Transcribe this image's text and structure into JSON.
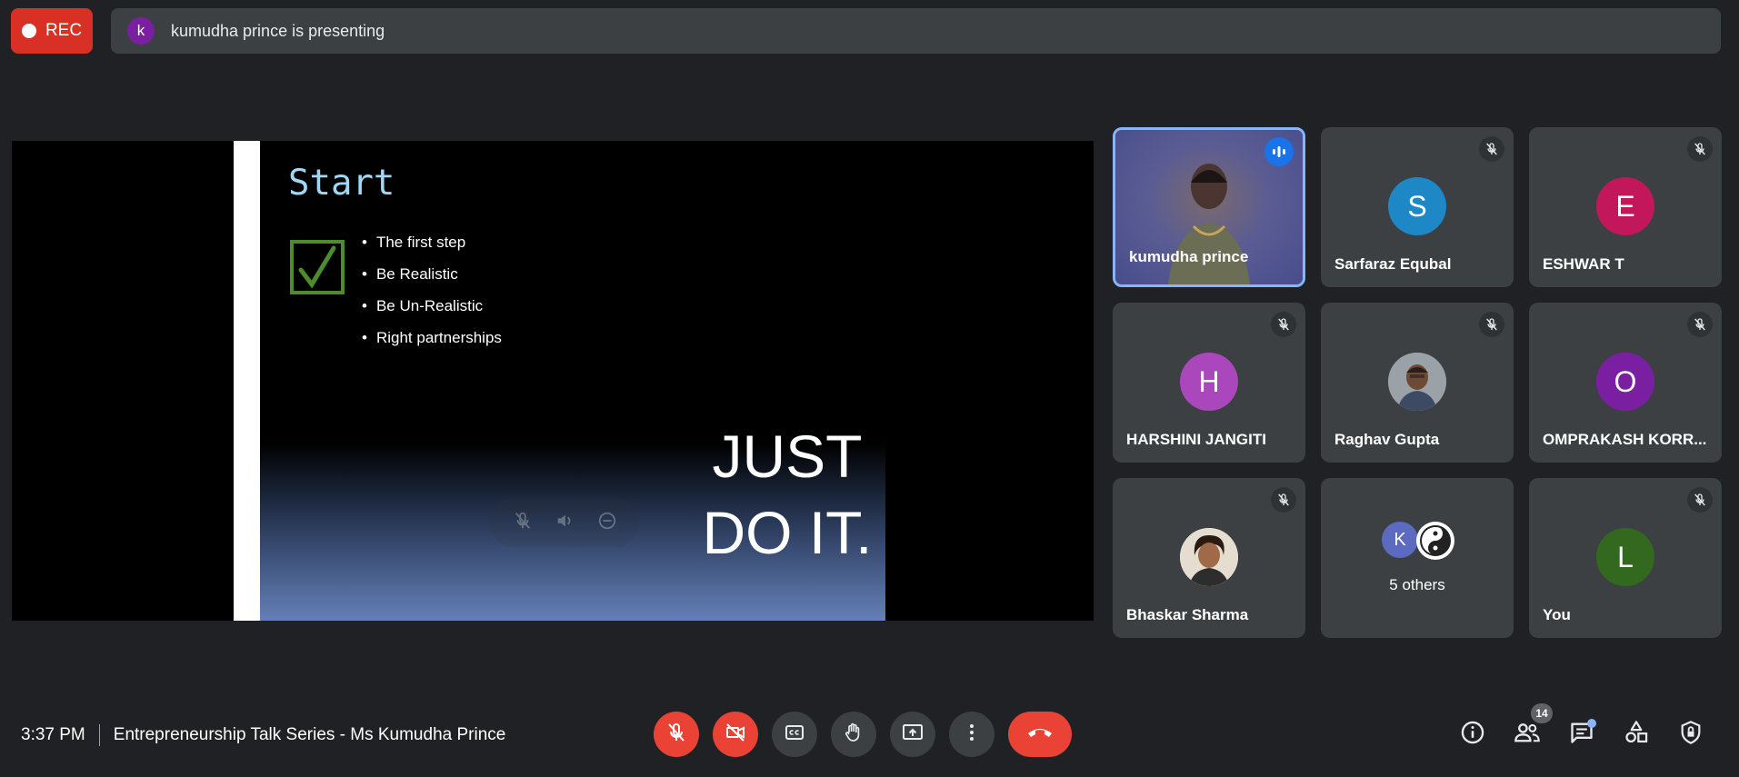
{
  "top_bar": {
    "rec_label": "REC",
    "presenter_initial": "k",
    "presenting_text": "kumudha prince is presenting"
  },
  "slide": {
    "title": "Start",
    "bullets": [
      "The first step",
      "Be Realistic",
      "Be Un-Realistic",
      "Right partnerships"
    ],
    "big_text_line1": "JUST",
    "big_text_line2": "DO IT."
  },
  "participants": [
    {
      "name": "kumudha prince",
      "type": "video",
      "speaking": true
    },
    {
      "name": "Sarfaraz Equbal",
      "initial": "S",
      "color": "#1e88c7",
      "muted": true
    },
    {
      "name": "ESHWAR T",
      "initial": "E",
      "color": "#c2185b",
      "muted": true
    },
    {
      "name": "HARSHINI JANGITI",
      "initial": "H",
      "color": "#ab47bc",
      "muted": true
    },
    {
      "name": "Raghav Gupta",
      "type": "photo",
      "muted": true
    },
    {
      "name": "OMPRAKASH KORR...",
      "initial": "O",
      "color": "#7b1fa2",
      "muted": true
    },
    {
      "name": "Bhaskar Sharma",
      "type": "photo",
      "muted": true
    },
    {
      "name": "5 others",
      "type": "others",
      "initial": "K"
    },
    {
      "name": "You",
      "initial": "L",
      "color": "#33691e",
      "muted": true
    }
  ],
  "bottom_bar": {
    "time": "3:37 PM",
    "meeting_title": "Entrepreneurship Talk Series - Ms Kumudha Prince",
    "people_count": "14"
  },
  "colors": {
    "background": "#202124",
    "tile": "#3c4043",
    "danger": "#ea4335",
    "accent": "#8ab4f8"
  }
}
